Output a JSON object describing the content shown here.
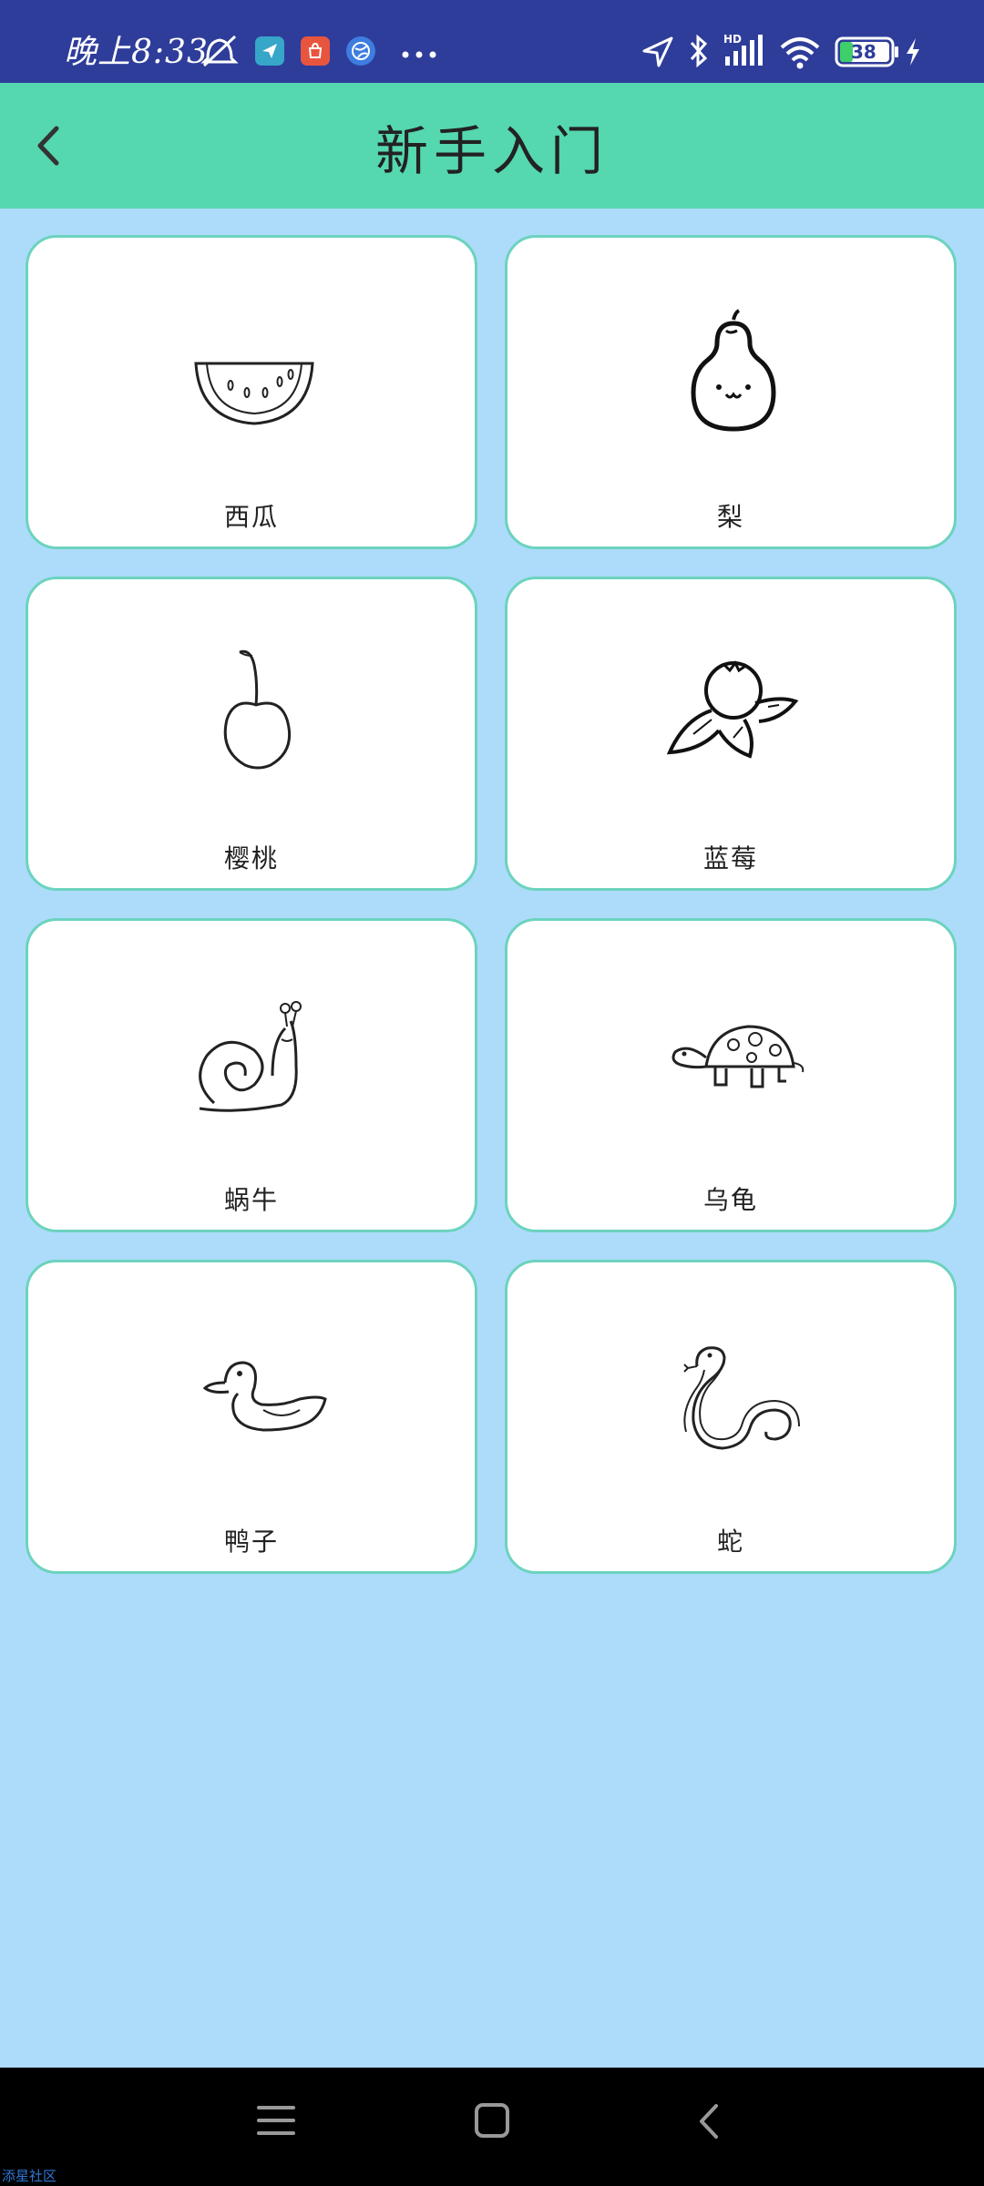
{
  "status_bar": {
    "time": "晚上8:33",
    "battery_level": "38",
    "network": "HD",
    "icons": [
      "mute-icon",
      "telegram-icon",
      "shopping-icon",
      "browser-icon",
      "more-icon",
      "location-icon",
      "bluetooth-icon",
      "signal-icon",
      "wifi-icon",
      "battery-icon",
      "charging-icon"
    ]
  },
  "header": {
    "title": "新手入门",
    "back_icon": "chevron-left-icon"
  },
  "cards": [
    {
      "label": "西瓜",
      "icon": "watermelon-drawing"
    },
    {
      "label": "梨",
      "icon": "pear-drawing"
    },
    {
      "label": "樱桃",
      "icon": "cherry-drawing"
    },
    {
      "label": "蓝莓",
      "icon": "blueberry-drawing"
    },
    {
      "label": "蜗牛",
      "icon": "snail-drawing"
    },
    {
      "label": "乌龟",
      "icon": "turtle-drawing"
    },
    {
      "label": "鸭子",
      "icon": "duck-drawing"
    },
    {
      "label": "蛇",
      "icon": "snake-drawing"
    }
  ],
  "nav_bar": {
    "menu_icon": "menu-icon",
    "home_icon": "home-icon",
    "back_icon": "back-icon"
  },
  "watermark": "添星社区",
  "colors": {
    "status_bar": "#2E3D9A",
    "header": "#55D7B0",
    "background": "#ADDCFB",
    "card_border": "#6CD3BE",
    "nav_bar": "#000000"
  }
}
